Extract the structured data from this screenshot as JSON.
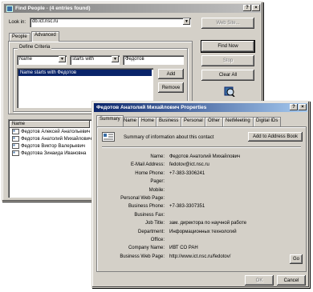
{
  "find_window": {
    "title": "Find People - (4 entries found)",
    "look_in_label": "Look in:",
    "look_in_value": "db.ict.nsc.ru",
    "web_site_button": "Web Site...",
    "tabs": [
      "People",
      "Advanced"
    ],
    "group_title": "Define Criteria",
    "criteria": {
      "field": "Name",
      "condition": "starts with",
      "value": "Федотов"
    },
    "criteria_list": [
      "Name starts with Федотов"
    ],
    "buttons": {
      "find_now": "Find Now",
      "stop": "Stop",
      "clear_all": "Clear All",
      "add": "Add",
      "remove": "Remove"
    },
    "results_header": "Name",
    "results": [
      "Федотов Алексей Анатольевич",
      "Федотов Анатолий Михайлович",
      "Федотов Виктор Валерьевич",
      "Федотова Зинаида Ивановна"
    ]
  },
  "props_window": {
    "title": "Федотов Анатолий Михайлович Properties",
    "tabs": [
      "Summary",
      "Name",
      "Home",
      "Business",
      "Personal",
      "Other",
      "NetMeeting",
      "Digital IDs"
    ],
    "summary_text": "Summary of information about this contact",
    "add_button": "Add to Address Book",
    "fields": [
      {
        "label": "Name:",
        "value": "Федотов Анатолий Михайлович"
      },
      {
        "label": "E-Mail Address:",
        "value": "fedotov@ict.nsc.ru"
      },
      {
        "label": "Home Phone:",
        "value": "+7-383-3306241"
      },
      {
        "label": "Pager:",
        "value": ""
      },
      {
        "label": "Mobile:",
        "value": ""
      },
      {
        "label": "Personal Web Page:",
        "value": ""
      },
      {
        "label": "Business Phone:",
        "value": "+7-383-3307351"
      },
      {
        "label": "Business Fax:",
        "value": ""
      },
      {
        "label": "Job Title:",
        "value": "зам. директора по научной работе"
      },
      {
        "label": "Department:",
        "value": "Информационных технологий"
      },
      {
        "label": "Office:",
        "value": ""
      },
      {
        "label": "Company Name:",
        "value": "ИВТ СО РАН"
      },
      {
        "label": "Business Web Page:",
        "value": "http://www.ict.nsc.ru/fedotov/"
      }
    ],
    "go_button": "Go",
    "ok_button": "OK",
    "cancel_button": "Cancel"
  },
  "colors": {
    "titlebar_active": "#0a246a",
    "titlebar_inactive": "#808080",
    "selection": "#0a246a",
    "face": "#d4d0c8"
  }
}
